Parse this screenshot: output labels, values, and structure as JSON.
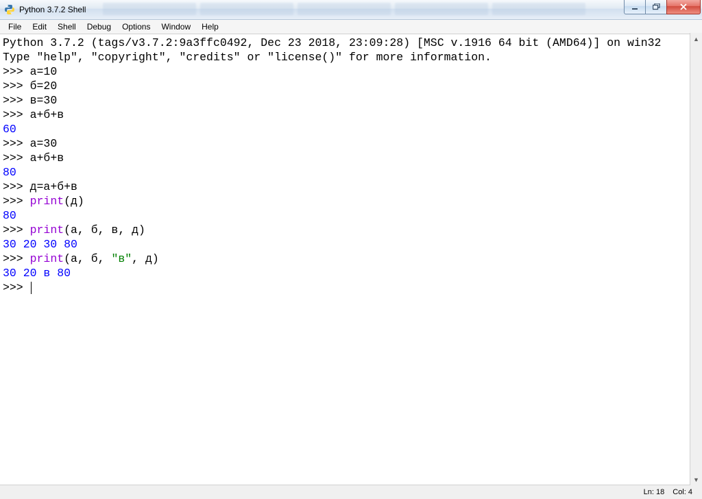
{
  "titlebar": {
    "title": "Python 3.7.2 Shell"
  },
  "menubar": {
    "items": [
      "File",
      "Edit",
      "Shell",
      "Debug",
      "Options",
      "Window",
      "Help"
    ]
  },
  "shell": {
    "banner1": "Python 3.7.2 (tags/v3.7.2:9a3ffc0492, Dec 23 2018, 23:09:28) [MSC v.1916 64 bit (AMD64)] on win32",
    "banner2": "Type \"help\", \"copyright\", \"credits\" or \"license()\" for more information.",
    "prompt": ">>> ",
    "lines": {
      "l1": "а=10",
      "l2": "б=20",
      "l3": "в=30",
      "l4": "а+б+в",
      "o4": "60",
      "l5": "а=30",
      "l6": "а+б+в",
      "o6": "80",
      "l7": "д=а+б+в",
      "l8_pre": "",
      "l8_fn": "print",
      "l8_post": "(д)",
      "o8": "80",
      "l9_fn": "print",
      "l9_post": "(а, б, в, д)",
      "o9": "30 20 30 80",
      "l10_fn": "print",
      "l10_mid1": "(а, б, ",
      "l10_str": "\"в\"",
      "l10_mid2": ", д)",
      "o10": "30 20 в 80"
    }
  },
  "statusbar": {
    "ln": "Ln: 18",
    "col": "Col: 4"
  }
}
